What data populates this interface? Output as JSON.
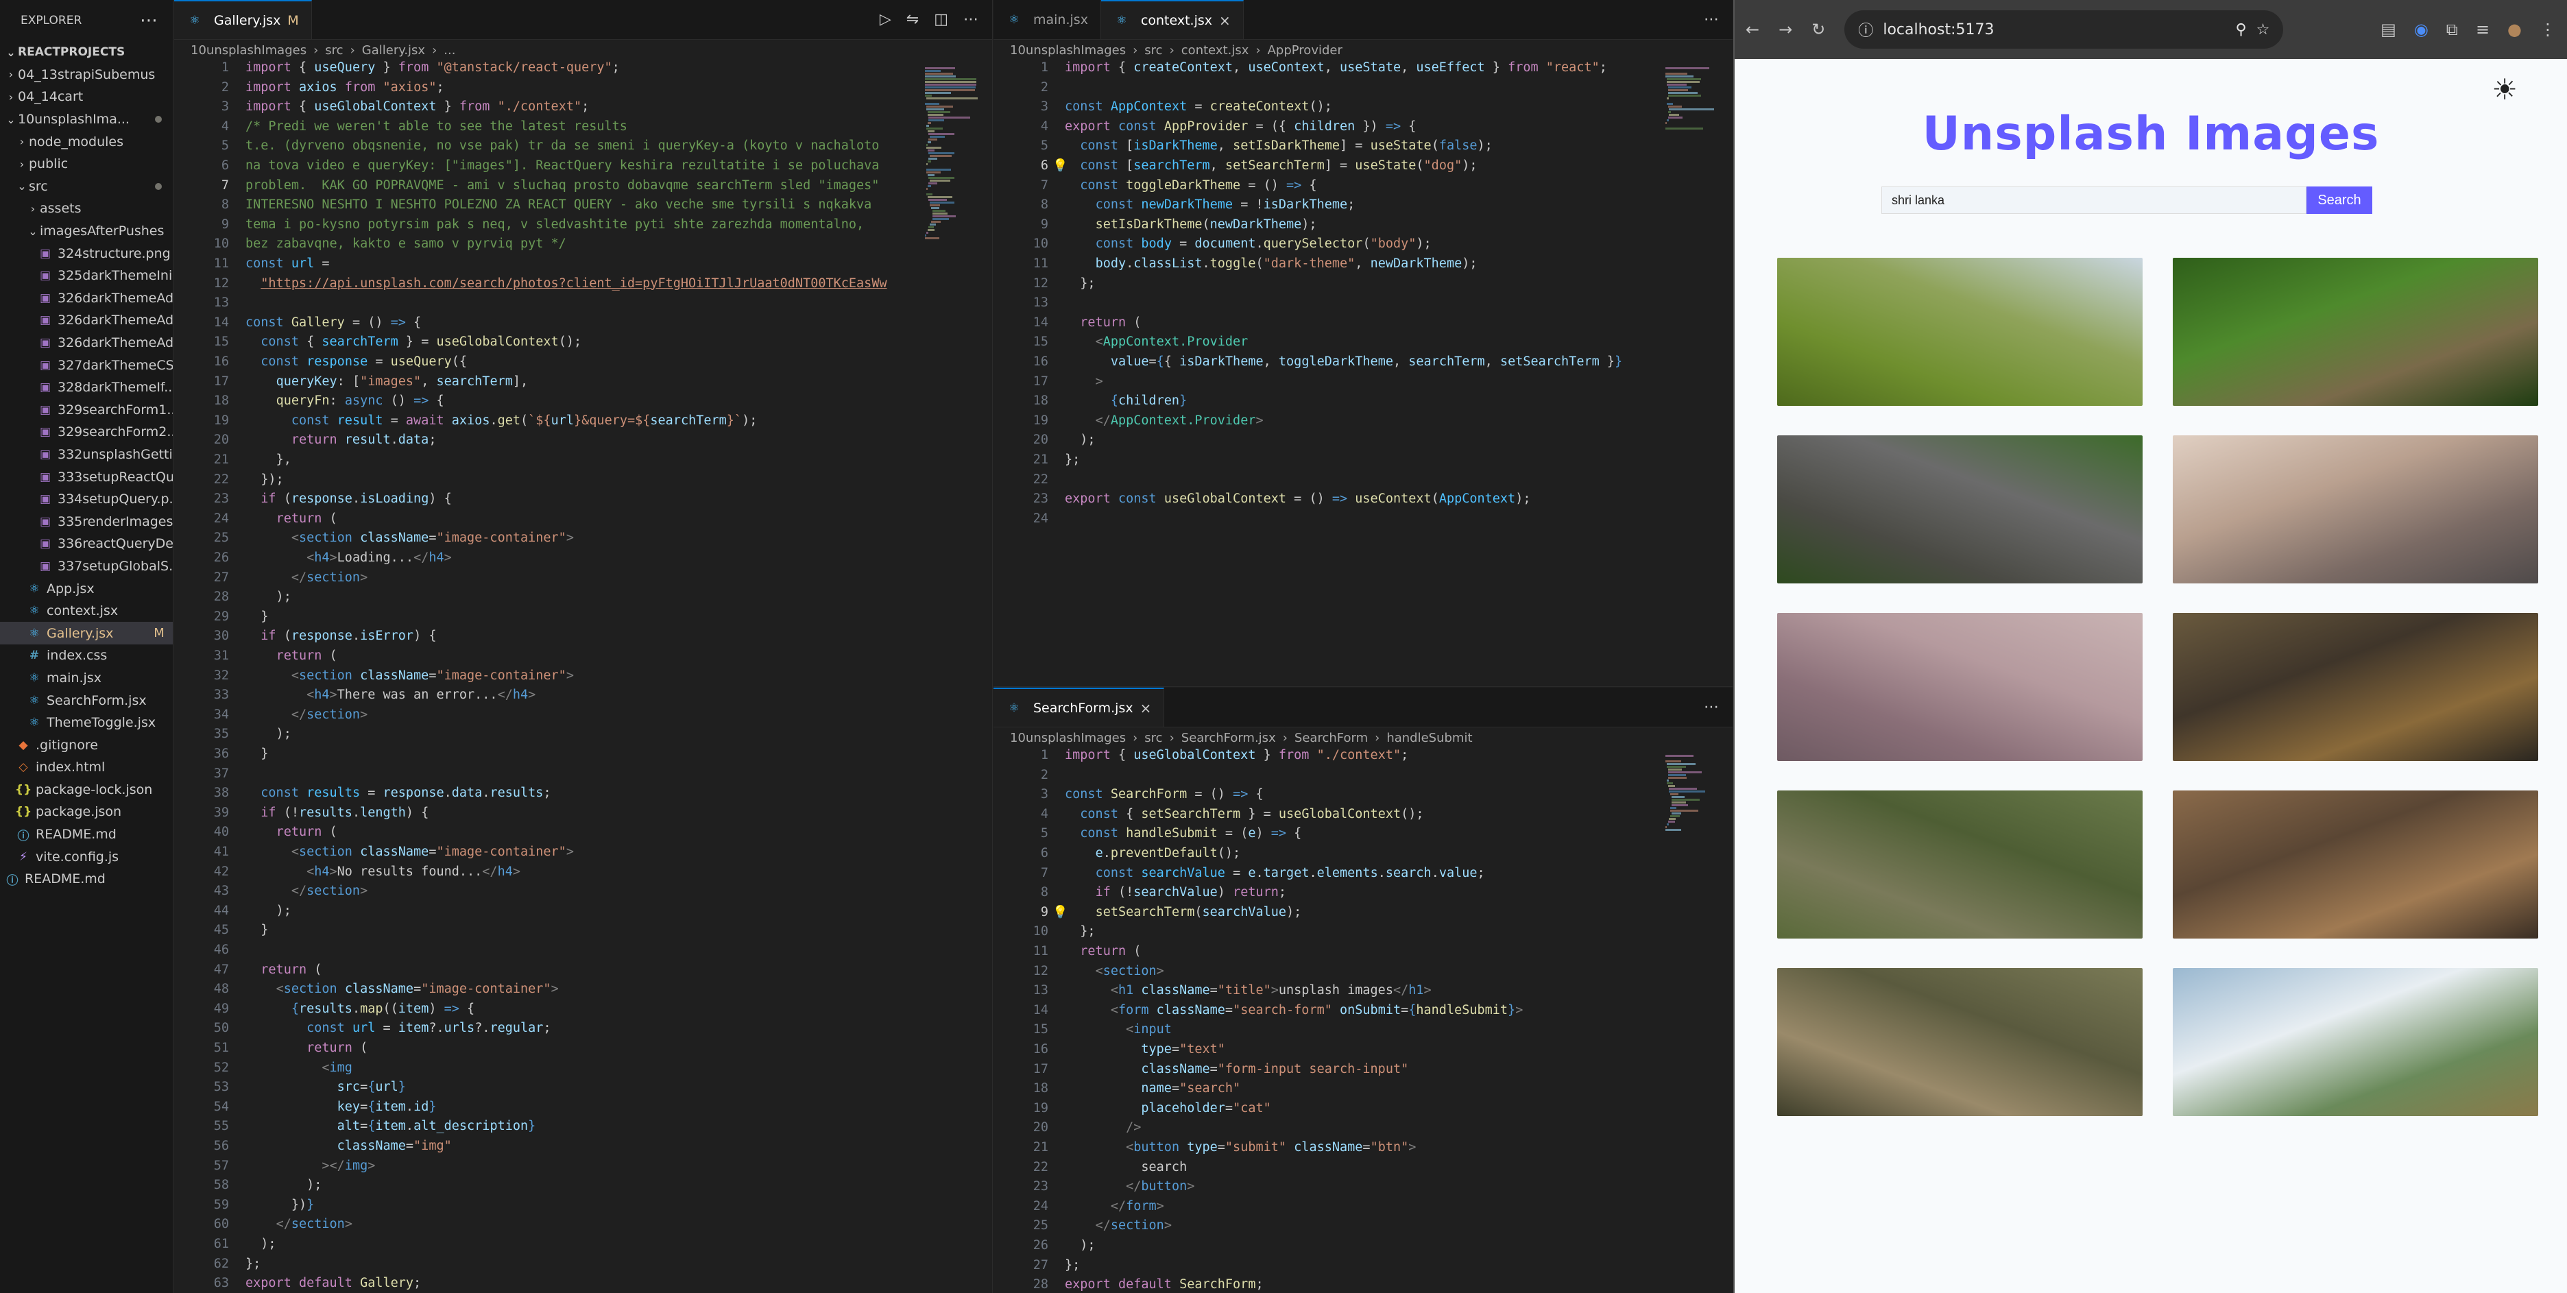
{
  "explorer": {
    "title": "EXPLORER",
    "project": "REACTPROJECTS",
    "items": [
      {
        "label": "04_13strapiSubemus",
        "kind": "folder",
        "depth": 1,
        "open": false
      },
      {
        "label": "04_14cart",
        "kind": "folder",
        "depth": 1,
        "open": false
      },
      {
        "label": "10unsplashIma...",
        "kind": "folder",
        "depth": 1,
        "open": true,
        "modified": true
      },
      {
        "label": "node_modules",
        "kind": "folder",
        "depth": 2,
        "open": false
      },
      {
        "label": "public",
        "kind": "folder",
        "depth": 2,
        "open": false
      },
      {
        "label": "src",
        "kind": "folder",
        "depth": 2,
        "open": true,
        "modified": true
      },
      {
        "label": "assets",
        "kind": "folder",
        "depth": 3,
        "open": false
      },
      {
        "label": "imagesAfterPushes",
        "kind": "folder",
        "depth": 3,
        "open": true
      },
      {
        "label": "324structure.png",
        "kind": "img",
        "depth": 4
      },
      {
        "label": "325darkThemeIni...",
        "kind": "img",
        "depth": 4
      },
      {
        "label": "326darkThemeAd...",
        "kind": "img",
        "depth": 4
      },
      {
        "label": "326darkThemeAd...",
        "kind": "img",
        "depth": 4
      },
      {
        "label": "326darkThemeAd...",
        "kind": "img",
        "depth": 4
      },
      {
        "label": "327darkThemeCS...",
        "kind": "img",
        "depth": 4
      },
      {
        "label": "328darkThemeIf...",
        "kind": "img",
        "depth": 4
      },
      {
        "label": "329searchForm1...",
        "kind": "img",
        "depth": 4
      },
      {
        "label": "329searchForm2....",
        "kind": "img",
        "depth": 4
      },
      {
        "label": "332unsplashGetti...",
        "kind": "img",
        "depth": 4
      },
      {
        "label": "333setupReactQu...",
        "kind": "img",
        "depth": 4
      },
      {
        "label": "334setupQuery.p...",
        "kind": "img",
        "depth": 4
      },
      {
        "label": "335renderImages...",
        "kind": "img",
        "depth": 4
      },
      {
        "label": "336reactQueryDe...",
        "kind": "img",
        "depth": 4
      },
      {
        "label": "337setupGlobalS...",
        "kind": "img",
        "depth": 4
      },
      {
        "label": "App.jsx",
        "kind": "react",
        "depth": 3
      },
      {
        "label": "context.jsx",
        "kind": "react",
        "depth": 3
      },
      {
        "label": "Gallery.jsx",
        "kind": "react",
        "depth": 3,
        "selected": true,
        "badge": "M"
      },
      {
        "label": "index.css",
        "kind": "css",
        "depth": 3
      },
      {
        "label": "main.jsx",
        "kind": "react",
        "depth": 3
      },
      {
        "label": "SearchForm.jsx",
        "kind": "react",
        "depth": 3
      },
      {
        "label": "ThemeToggle.jsx",
        "kind": "react",
        "depth": 3
      },
      {
        "label": ".gitignore",
        "kind": "git",
        "depth": 2
      },
      {
        "label": "index.html",
        "kind": "html",
        "depth": 2
      },
      {
        "label": "package-lock.json",
        "kind": "json",
        "depth": 2
      },
      {
        "label": "package.json",
        "kind": "json",
        "depth": 2
      },
      {
        "label": "README.md",
        "kind": "md",
        "depth": 2
      },
      {
        "label": "vite.config.js",
        "kind": "vite",
        "depth": 2
      },
      {
        "label": "README.md",
        "kind": "md",
        "depth": 1
      }
    ]
  },
  "editor_left": {
    "tab": "Gallery.jsx",
    "tab_badge": "M",
    "breadcrumb": [
      "10unsplashImages",
      "src",
      "Gallery.jsx",
      "..."
    ],
    "start_line": 1,
    "current_line": 7,
    "lines": [
      "<k>import</k> { <v>useQuery</v> } <k>from</k> <s>\"@tanstack/react-query\"</s>;",
      "<k>import</k> <v>axios</v> <k>from</k> <s>\"axios\"</s>;",
      "<k>import</k> { <v>useGlobalContext</v> } <k>from</k> <s>\"./context\"</s>;",
      "<c>/* Predi we weren't able to see the latest results</c>",
      "<c>t.e. (dyrveno obqsnenie, no vse pak) tr da se smeni i queryKey-a (koyto v nachaloto</c>",
      "<c>na tova video e queryKey: [\"images\"]. ReactQuery keshira rezultatite i se poluchava</c>",
      "<c>problem.  KAK GO POPRAVQME - ami v sluchaq prosto dobavqme searchTerm sled \"images\"</c>",
      "<c>INTERESNO NESHTO I NESHTO POLEZNO ZA REACT QUERY - ako veche sme tyrsili s nqkakva</c>",
      "<c>tema i po-kysno potyrsim pak s neq, v sledvashtite pyti shte zarezhda momentalno,</c>",
      "<c>bez zabavqne, kakto e samo v pyrviq pyt */</c>",
      "<b>const</b> <cn>url</cn> =",
      "  <s><u>\"https://api.unsplash.com/search/photos?client_id=pyFtgHOiITJlJrUaat0dNT00TKcEasWw</u></s>",
      "",
      "<b>const</b> <f>Gallery</f> = () <b>=></b> {",
      "  <b>const</b> { <cn>searchTerm</cn> } = <f>useGlobalContext</f>();",
      "  <b>const</b> <cn>response</cn> = <f>useQuery</f>({",
      "    <v>queryKey</v>: [<s>\"images\"</s>, <v>searchTerm</v>],",
      "    <f>queryFn</f>: <b>async</b> () <b>=></b> {",
      "      <b>const</b> <cn>result</cn> = <k>await</k> <v>axios</v>.<f>get</f>(<s>`${</s><v>url</v><s>}&query=${</s><v>searchTerm</v><s>}`</s>);",
      "      <k>return</k> <v>result</v>.<v>data</v>;",
      "    },",
      "  });",
      "  <k>if</k> (<v>response</v>.<v>isLoading</v>) {",
      "    <k>return</k> (",
      "      <g><</g><b>section</b> <v>className</v>=<s>\"image-container\"</s><g>></g>",
      "        <g><</g><b>h4</b><g>></g>Loading...<g></</g><b>h4</b><g>></g>",
      "      <g></</g><b>section</b><g>></g>",
      "    );",
      "  }",
      "  <k>if</k> (<v>response</v>.<v>isError</v>) {",
      "    <k>return</k> (",
      "      <g><</g><b>section</b> <v>className</v>=<s>\"image-container\"</s><g>></g>",
      "        <g><</g><b>h4</b><g>></g>There was an error...<g></</g><b>h4</b><g>></g>",
      "      <g></</g><b>section</b><g>></g>",
      "    );",
      "  }",
      "",
      "  <b>const</b> <cn>results</cn> = <v>response</v>.<v>data</v>.<v>results</v>;",
      "  <k>if</k> (!<v>results</v>.<v>length</v>) {",
      "    <k>return</k> (",
      "      <g><</g><b>section</b> <v>className</v>=<s>\"image-container\"</s><g>></g>",
      "        <g><</g><b>h4</b><g>></g>No results found...<g></</g><b>h4</b><g>></g>",
      "      <g></</g><b>section</b><g>></g>",
      "    );",
      "  }",
      "",
      "  <k>return</k> (",
      "    <g><</g><b>section</b> <v>className</v>=<s>\"image-container\"</s><g>></g>",
      "      <b>{</b><v>results</v>.<f>map</f>((<v>item</v>) <b>=></b> {",
      "        <b>const</b> <cn>url</cn> = <v>item</v>?.<v>urls</v>?.<v>regular</v>;",
      "        <k>return</k> (",
      "          <g><</g><b>img</b>",
      "            <v>src</v>=<b>{</b><v>url</v><b>}</b>",
      "            <v>key</v>=<b>{</b><v>item</v>.<v>id</v><b>}</b>",
      "            <v>alt</v>=<b>{</b><v>item</v>.<v>alt_description</v><b>}</b>",
      "            <v>className</v>=<s>\"img\"</s>",
      "          <g>></</g><b>img</b><g>></g>",
      "        );",
      "      })<b>}</b>",
      "    <g></</g><b>section</b><g>></g>",
      "  );",
      "};",
      "<k>export</k> <k>default</k> <f>Gallery</f>;"
    ]
  },
  "editor_top_right": {
    "tabs": [
      "main.jsx",
      "context.jsx"
    ],
    "active_tab": "context.jsx",
    "breadcrumb": [
      "10unsplashImages",
      "src",
      "context.jsx",
      "AppProvider"
    ],
    "start_line": 1,
    "current_line": 6,
    "lines": [
      "<k>import</k> { <v>createContext</v>, <v>useContext</v>, <v>useState</v>, <v>useEffect</v> } <k>from</k> <s>\"react\"</s>;",
      "",
      "<b>const</b> <cn>AppContext</cn> = <f>createContext</f>();",
      "<k>export</k> <b>const</b> <f>AppProvider</f> = ({ <v>children</v> }) <b>=></b> {",
      "  <b>const</b> [<cn>isDarkTheme</cn>, <f>setIsDarkTheme</f>] = <f>useState</f>(<b>false</b>);",
      "  <b>const</b> [<cn>searchTerm</cn>, <f>setSearchTerm</f>] = <f>useState</f>(<s>\"dog\"</s>);",
      "  <b>const</b> <f>toggleDarkTheme</f> = () <b>=></b> {",
      "    <b>const</b> <cn>newDarkTheme</cn> = !<v>isDarkTheme</v>;",
      "    <f>setIsDarkTheme</f>(<v>newDarkTheme</v>);",
      "    <b>const</b> <cn>body</cn> = <v>document</v>.<f>querySelector</f>(<s>\"body\"</s>);",
      "    <v>body</v>.<v>classList</v>.<f>toggle</f>(<s>\"dark-theme\"</s>, <v>newDarkTheme</v>);",
      "  };",
      "",
      "  <k>return</k> (",
      "    <g><</g><t>AppContext.Provider</t>",
      "      <v>value</v>=<b>{</b>{ <v>isDarkTheme</v>, <v>toggleDarkTheme</v>, <v>searchTerm</v>, <v>setSearchTerm</v> }<b>}</b>",
      "    <g>></g>",
      "      <b>{</b><v>children</v><b>}</b>",
      "    <g></</g><t>AppContext.Provider</t><g>></g>",
      "  );",
      "};",
      "",
      "<k>export</k> <b>const</b> <f>useGlobalContext</f> = () <b>=></b> <f>useContext</f>(<cn>AppContext</cn>);",
      ""
    ]
  },
  "editor_bottom_right": {
    "tab": "SearchForm.jsx",
    "breadcrumb": [
      "10unsplashImages",
      "src",
      "SearchForm.jsx",
      "SearchForm",
      "handleSubmit"
    ],
    "start_line": 1,
    "current_line": 9,
    "lines": [
      "<k>import</k> { <v>useGlobalContext</v> } <k>from</k> <s>\"./context\"</s>;",
      "",
      "<b>const</b> <f>SearchForm</f> = () <b>=></b> {",
      "  <b>const</b> { <f>setSearchTerm</f> } = <f>useGlobalContext</f>();",
      "  <b>const</b> <f>handleSubmit</f> = (<v>e</v>) <b>=></b> {",
      "    <v>e</v>.<f>preventDefault</f>();",
      "    <b>const</b> <cn>searchValue</cn> = <v>e</v>.<v>target</v>.<v>elements</v>.<v>search</v>.<v>value</v>;",
      "    <k>if</k> (!<v>searchValue</v>) <k>return</k>;",
      "    <f>setSearchTerm</f>(<v>searchValue</v>);",
      "  };",
      "  <k>return</k> (",
      "    <g><</g><b>section</b><g>></g>",
      "      <g><</g><b>h1</b> <v>className</v>=<s>\"title\"</s><g>></g>unsplash images<g></</g><b>h1</b><g>></g>",
      "      <g><</g><b>form</b> <v>className</v>=<s>\"search-form\"</s> <v>onSubmit</v>=<b>{</b><f>handleSubmit</f><b>}</b><g>></g>",
      "        <g><</g><b>input</b>",
      "          <v>type</v>=<s>\"text\"</s>",
      "          <v>className</v>=<s>\"form-input search-input\"</s>",
      "          <v>name</v>=<s>\"search\"</s>",
      "          <v>placeholder</v>=<s>\"cat\"</s>",
      "        <g>/></g>",
      "        <g><</g><b>button</b> <v>type</v>=<s>\"submit\"</s> <v>className</v>=<s>\"btn\"</s><g>></g>",
      "          search",
      "        <g></</g><b>button</b><g>></g>",
      "      <g></</g><b>form</b><g>></g>",
      "    <g></</g><b>section</b><g>></g>",
      "  );",
      "};",
      "<k>export</k> <k>default</k> <f>SearchForm</f>;"
    ]
  },
  "browser": {
    "url": "localhost:5173",
    "page_title": "Unsplash Images",
    "search_value": "shri lanka",
    "search_button": "Search",
    "theme_toggle_icon": "sun-icon",
    "images": [
      {
        "name": "mangrove-birds-image",
        "colors": [
          "#c9d6e0",
          "#8fa35a",
          "#6f8f2e",
          "#4e6a1c"
        ]
      },
      {
        "name": "lizard-image",
        "colors": [
          "#2f5f1a",
          "#4e8a2c",
          "#7a6a4a",
          "#1f3d12"
        ]
      },
      {
        "name": "elephant-image",
        "colors": [
          "#3d6b2a",
          "#6b6b6b",
          "#4a4a44",
          "#2e4a1f"
        ]
      },
      {
        "name": "beach-sunset-image",
        "colors": [
          "#e0cfc2",
          "#b9a08f",
          "#7a6a64",
          "#4f4a4a"
        ]
      },
      {
        "name": "pink-beach-image",
        "colors": [
          "#c9b3b3",
          "#b59a9e",
          "#8a6f78",
          "#6e5a62"
        ]
      },
      {
        "name": "motorbikes-crowd-image",
        "colors": [
          "#6a5a3e",
          "#3f352a",
          "#8a6a3a",
          "#2a2620"
        ]
      },
      {
        "name": "squirrel-grass-image",
        "colors": [
          "#6a7a4a",
          "#4e5e34",
          "#7a7a5a",
          "#5a6a3a"
        ]
      },
      {
        "name": "elephant-eye-image",
        "colors": [
          "#8a6a4a",
          "#5a4634",
          "#a07a52",
          "#3a2e24"
        ]
      },
      {
        "name": "tea-picker-woman-image",
        "colors": [
          "#7a7a56",
          "#5a5a3e",
          "#9a8a6a",
          "#3e3e2a"
        ]
      },
      {
        "name": "clouds-hills-image",
        "colors": [
          "#9ab8d0",
          "#e8eef2",
          "#6a8a5a",
          "#8a7a4a"
        ]
      }
    ]
  }
}
